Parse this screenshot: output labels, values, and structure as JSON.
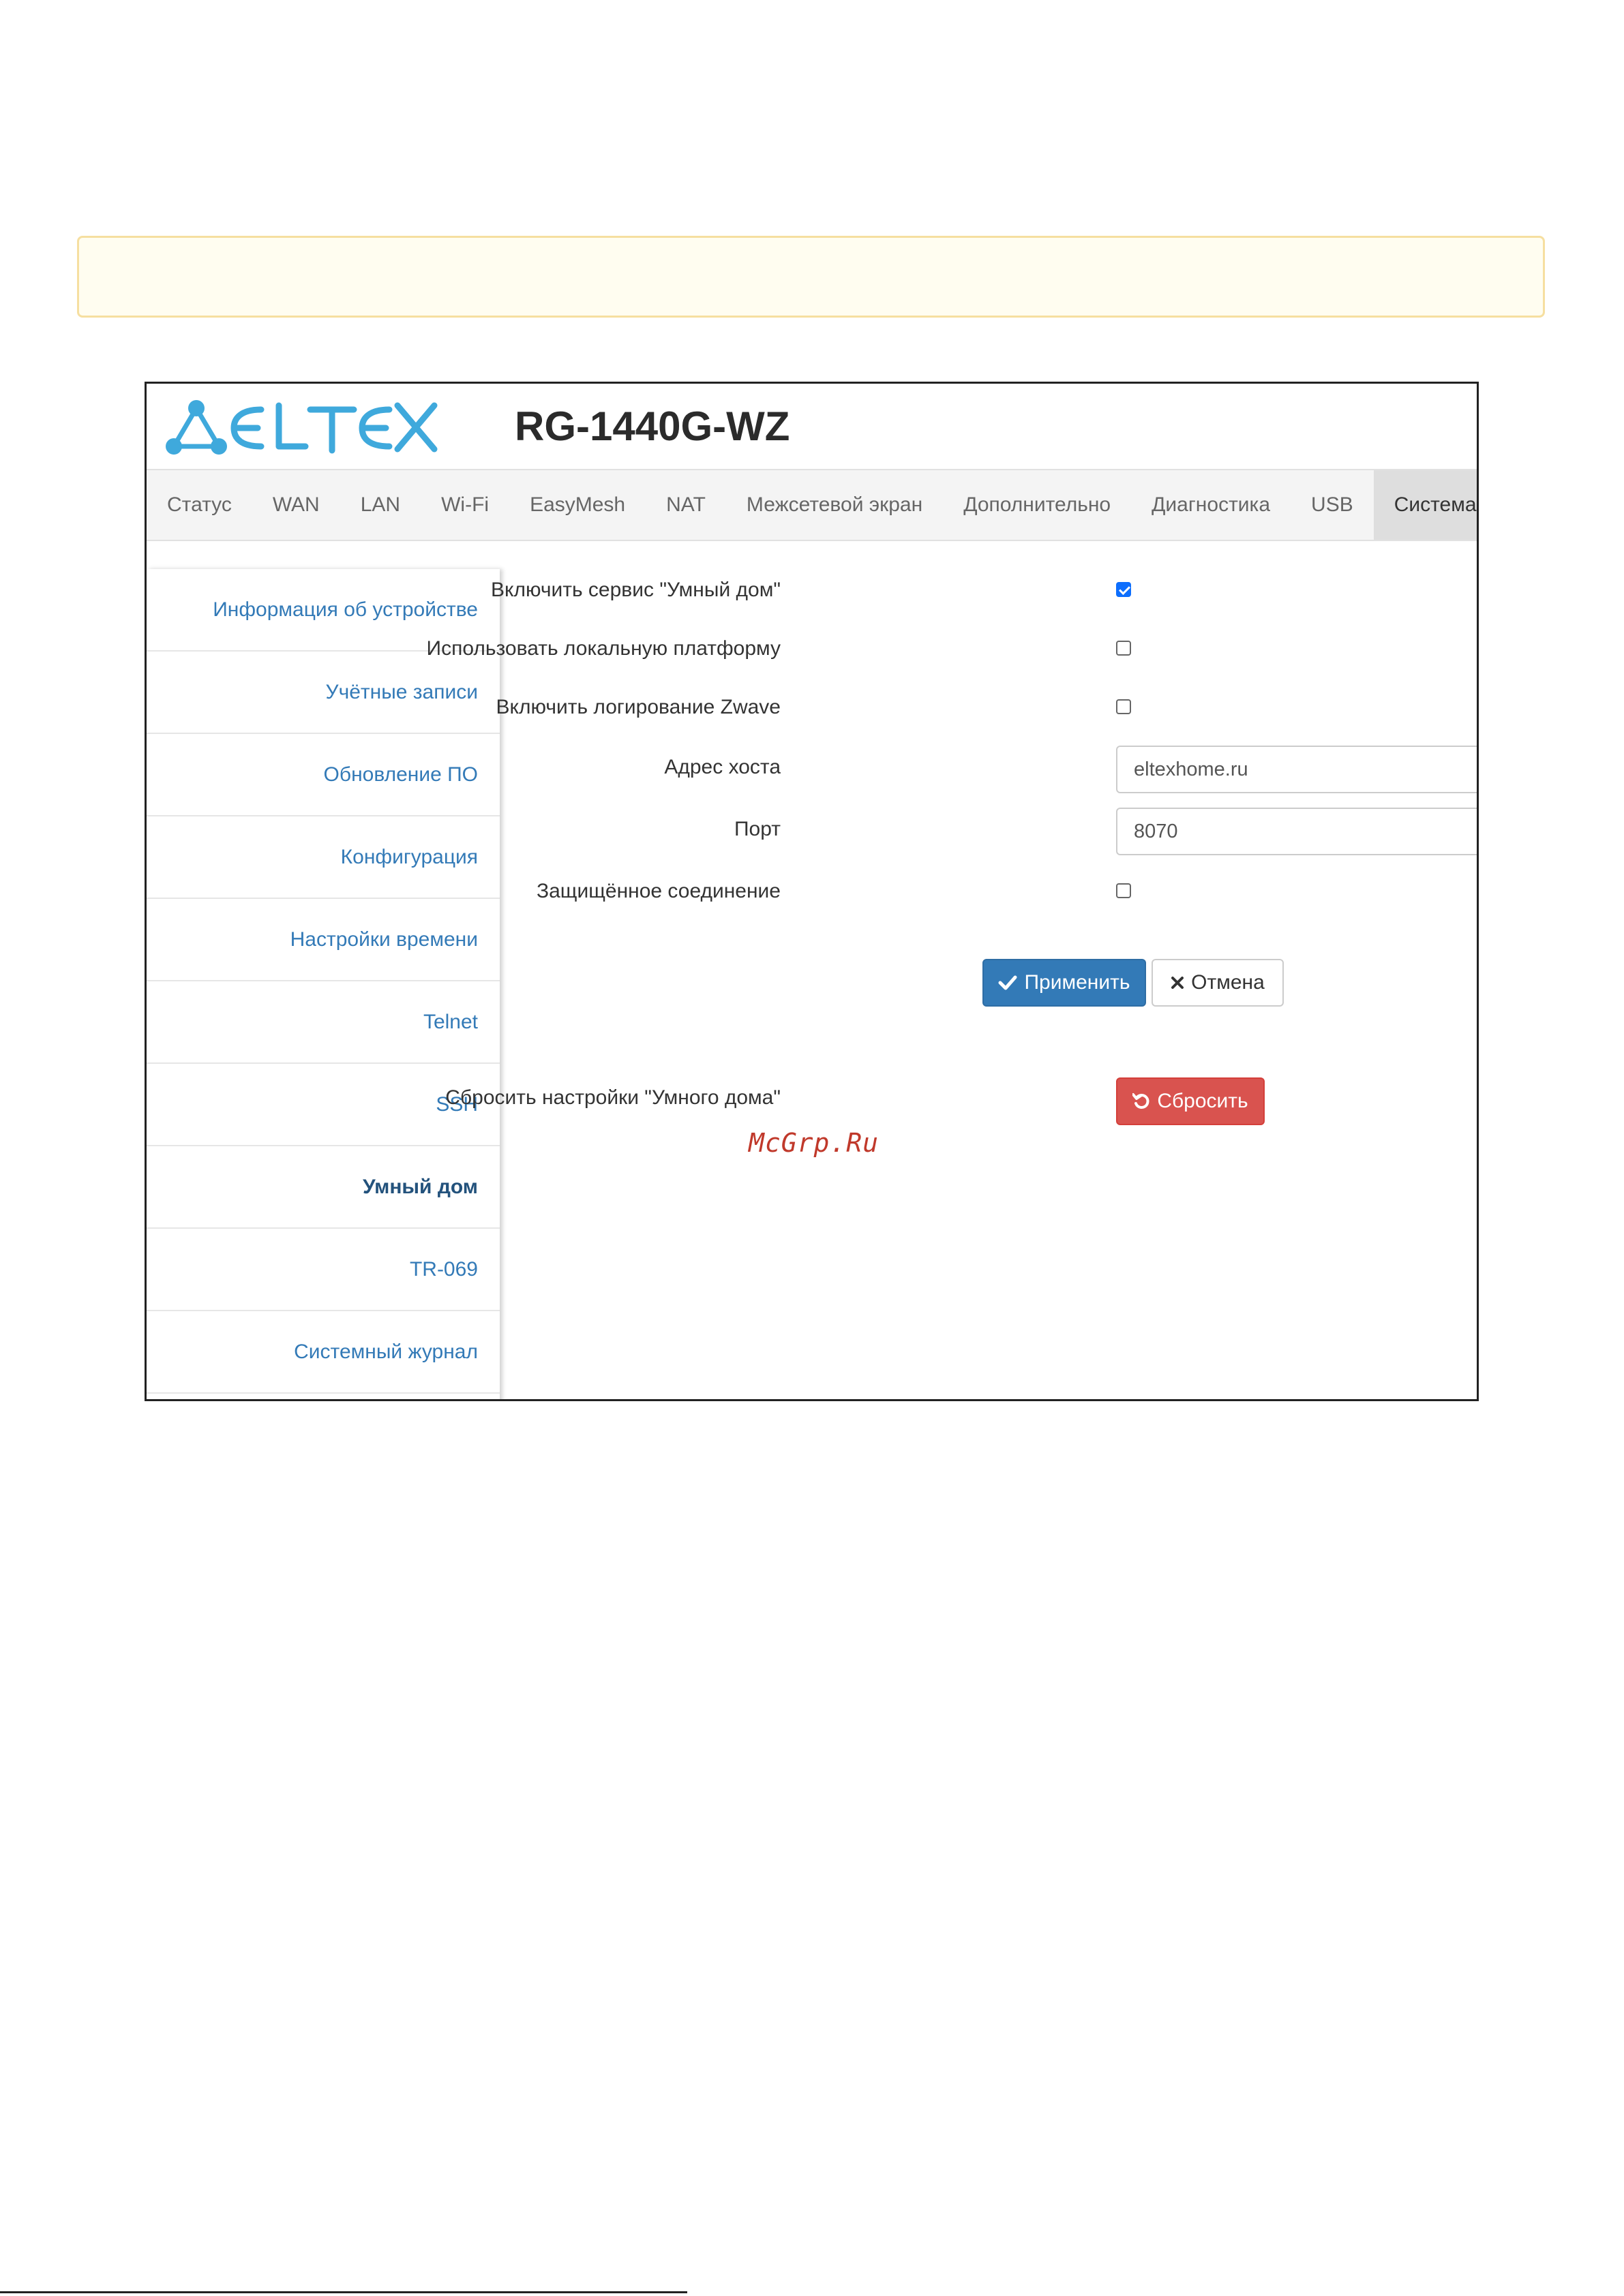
{
  "header": {
    "model": "RG-1440G-WZ"
  },
  "nav": {
    "tabs": [
      {
        "label": "Статус"
      },
      {
        "label": "WAN"
      },
      {
        "label": "LAN"
      },
      {
        "label": "Wi-Fi"
      },
      {
        "label": "EasyMesh"
      },
      {
        "label": "NAT"
      },
      {
        "label": "Межсетевой экран"
      },
      {
        "label": "Дополнительно"
      },
      {
        "label": "Диагностика"
      },
      {
        "label": "USB"
      },
      {
        "label": "Система",
        "active": true
      }
    ]
  },
  "sidebar": {
    "items": [
      {
        "label": "Информация об устройстве"
      },
      {
        "label": "Учётные записи"
      },
      {
        "label": "Обновление ПО"
      },
      {
        "label": "Конфигурация"
      },
      {
        "label": "Настройки времени"
      },
      {
        "label": "Telnet"
      },
      {
        "label": "SSH"
      },
      {
        "label": "Умный дом",
        "active": true
      },
      {
        "label": "TR-069"
      },
      {
        "label": "Системный журнал"
      }
    ]
  },
  "form": {
    "enable_service": {
      "label": "Включить сервис \"Умный дом\"",
      "checked": true
    },
    "use_local_platform": {
      "label": "Использовать локальную платформу",
      "checked": false
    },
    "enable_zwave_logging": {
      "label": "Включить логирование Zwave",
      "checked": false
    },
    "host_address": {
      "label": "Адрес хоста",
      "value": "eltexhome.ru"
    },
    "port": {
      "label": "Порт",
      "value": "8070"
    },
    "secure_connection": {
      "label": "Защищённое соединение",
      "checked": false
    },
    "apply_label": "Применить",
    "cancel_label": "Отмена",
    "reset": {
      "label": "Сбросить настройки \"Умного дома\"",
      "button_label": "Сбросить"
    }
  },
  "watermark": "McGrp.Ru",
  "colors": {
    "primary": "#337ab7",
    "danger": "#d9534f",
    "checkbox": "#0d6efd",
    "logo": "#3fa9dc"
  }
}
